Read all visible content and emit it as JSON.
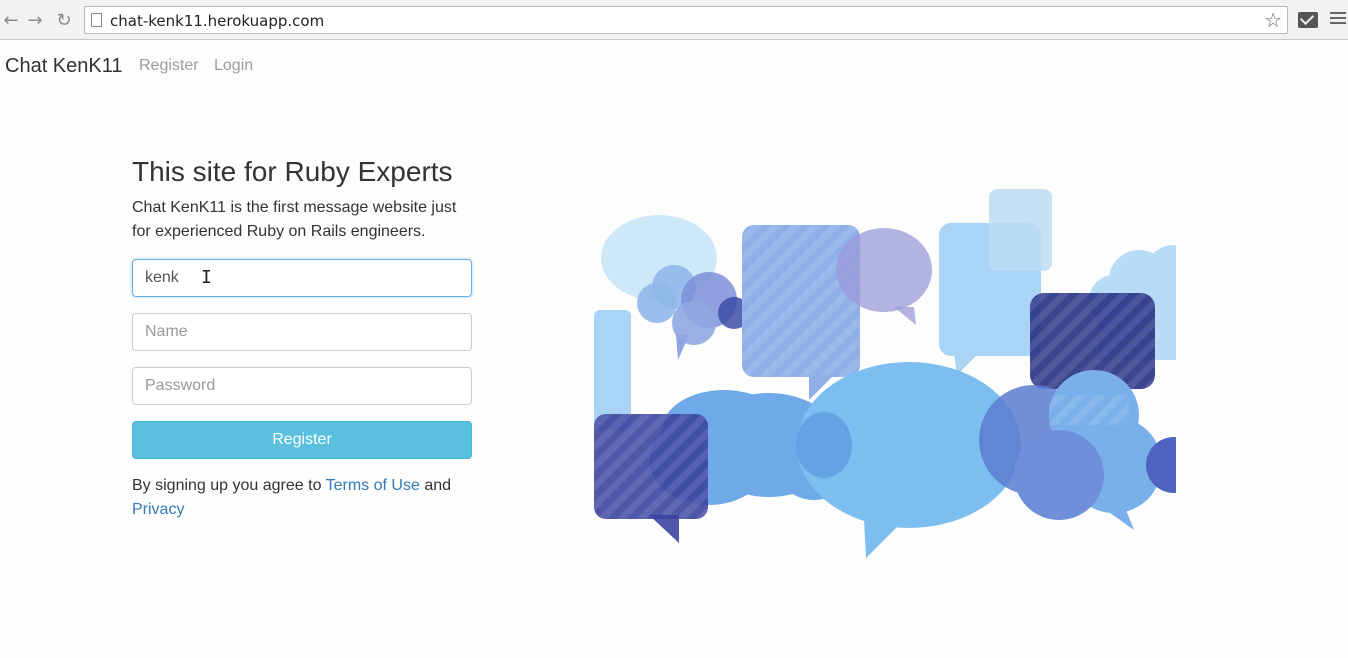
{
  "browser": {
    "url": "chat-kenk11.herokuapp.com",
    "back_icon": "back-arrow-icon",
    "forward_icon": "forward-arrow-icon",
    "reload_icon": "reload-icon"
  },
  "navbar": {
    "brand": "Chat KenK11",
    "links": [
      "Register",
      "Login"
    ]
  },
  "hero": {
    "title": "This site for Ruby Experts",
    "description": "Chat KenK11 is the first message website just for experienced Ruby on Rails engineers."
  },
  "form": {
    "username_value": "kenk",
    "name_placeholder": "Name",
    "password_placeholder": "Password",
    "submit_label": "Register"
  },
  "terms": {
    "prefix": "By signing up you agree to",
    "terms_link": "Terms of Use",
    "and": "and",
    "privacy_link": "Privacy"
  },
  "colors": {
    "accent": "#5bc0de",
    "link": "#337ab7",
    "bubble_light": "#a9d4f5",
    "bubble_mid": "#6fb7ee",
    "bubble_dark": "#2b3587"
  }
}
